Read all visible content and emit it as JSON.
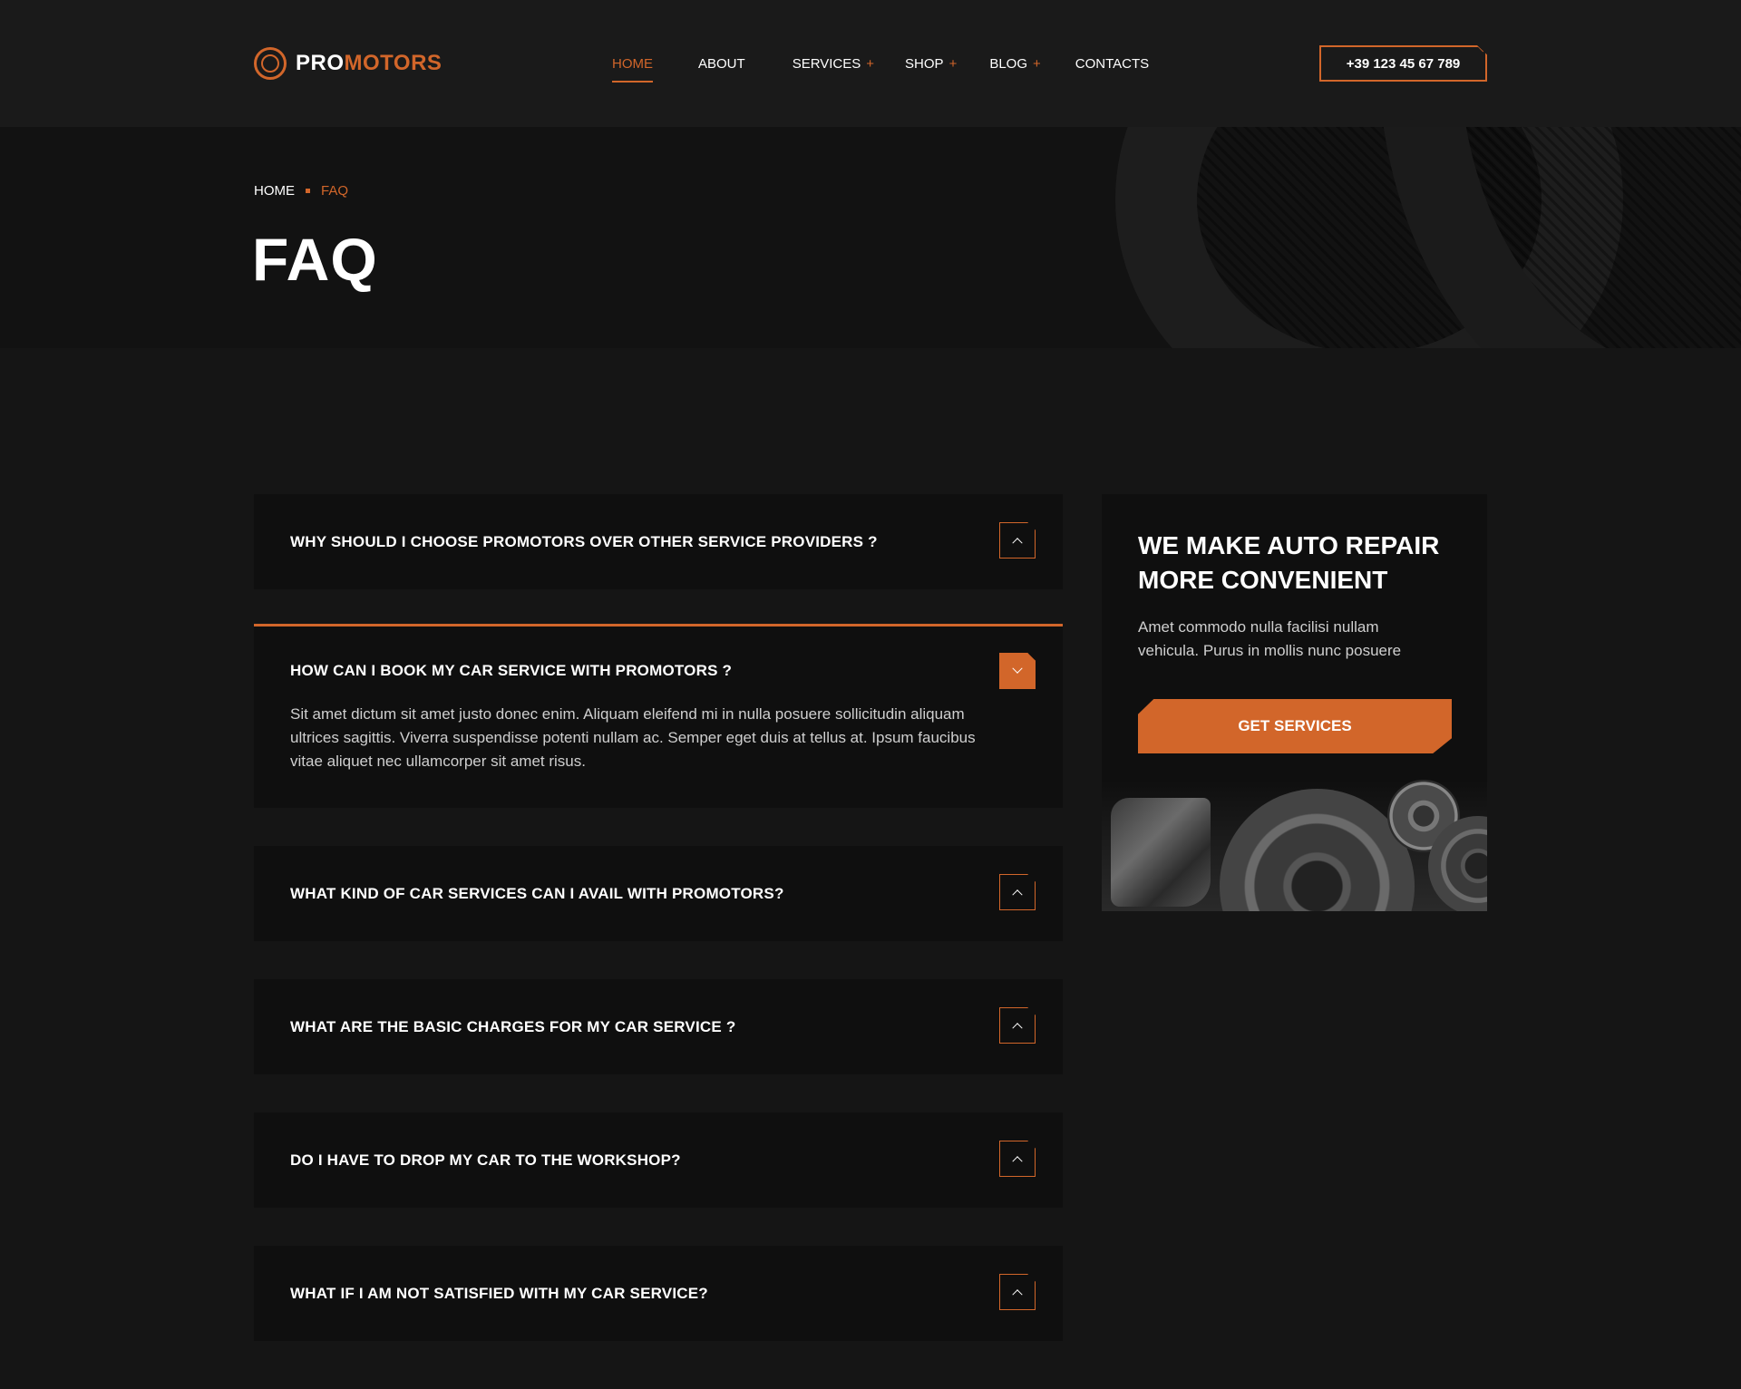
{
  "brand": {
    "pro": "PRO",
    "motors": "MOTORS"
  },
  "nav": {
    "items": [
      {
        "label": "HOME",
        "active": true,
        "has_submenu": false
      },
      {
        "label": "ABOUT",
        "active": false,
        "has_submenu": false
      },
      {
        "label": "SERVICES",
        "active": false,
        "has_submenu": true
      },
      {
        "label": "SHOP",
        "active": false,
        "has_submenu": true
      },
      {
        "label": "BLOG",
        "active": false,
        "has_submenu": true
      },
      {
        "label": "CONTACTS",
        "active": false,
        "has_submenu": false
      }
    ],
    "submenu_marker": "+"
  },
  "header": {
    "phone": "+39 123 45 67 789"
  },
  "breadcrumb": {
    "home": "HOME",
    "current": "FAQ"
  },
  "page": {
    "title": "FAQ"
  },
  "faq": {
    "items": [
      {
        "question": "WHY SHOULD I CHOOSE PROMOTORS OVER OTHER SERVICE PROVIDERS ?",
        "open": false
      },
      {
        "question": "HOW CAN I BOOK MY CAR SERVICE WITH PROMOTORS ?",
        "open": true,
        "answer": "Sit amet dictum sit amet justo donec enim. Aliquam eleifend mi in nulla posuere sollicitudin aliquam ultrices sagittis. Viverra suspendisse potenti nullam ac. Semper eget duis at tellus at. Ipsum faucibus vitae aliquet nec ullamcorper sit amet risus."
      },
      {
        "question": "WHAT KIND OF CAR SERVICES CAN I AVAIL WITH PROMOTORS?",
        "open": false
      },
      {
        "question": "WHAT ARE THE BASIC CHARGES FOR MY CAR SERVICE ?",
        "open": false
      },
      {
        "question": "DO I HAVE TO DROP MY CAR TO THE WORKSHOP?",
        "open": false
      },
      {
        "question": "WHAT IF I AM NOT SATISFIED WITH MY CAR SERVICE?",
        "open": false
      }
    ]
  },
  "sidebar": {
    "title": "WE MAKE AUTO REPAIR MORE CONVENIENT",
    "text": "Amet commodo nulla facilisi nullam vehicula. Purus in mollis nunc posuere",
    "cta": "GET SERVICES"
  },
  "colors": {
    "accent": "#d2662a",
    "background": "#151515",
    "card": "#0f0f0f",
    "header": "#1a1a1a"
  },
  "icons": {
    "logo": "wheel-icon",
    "toggle_closed": "chevron-up-icon",
    "toggle_open": "chevron-down-icon"
  }
}
